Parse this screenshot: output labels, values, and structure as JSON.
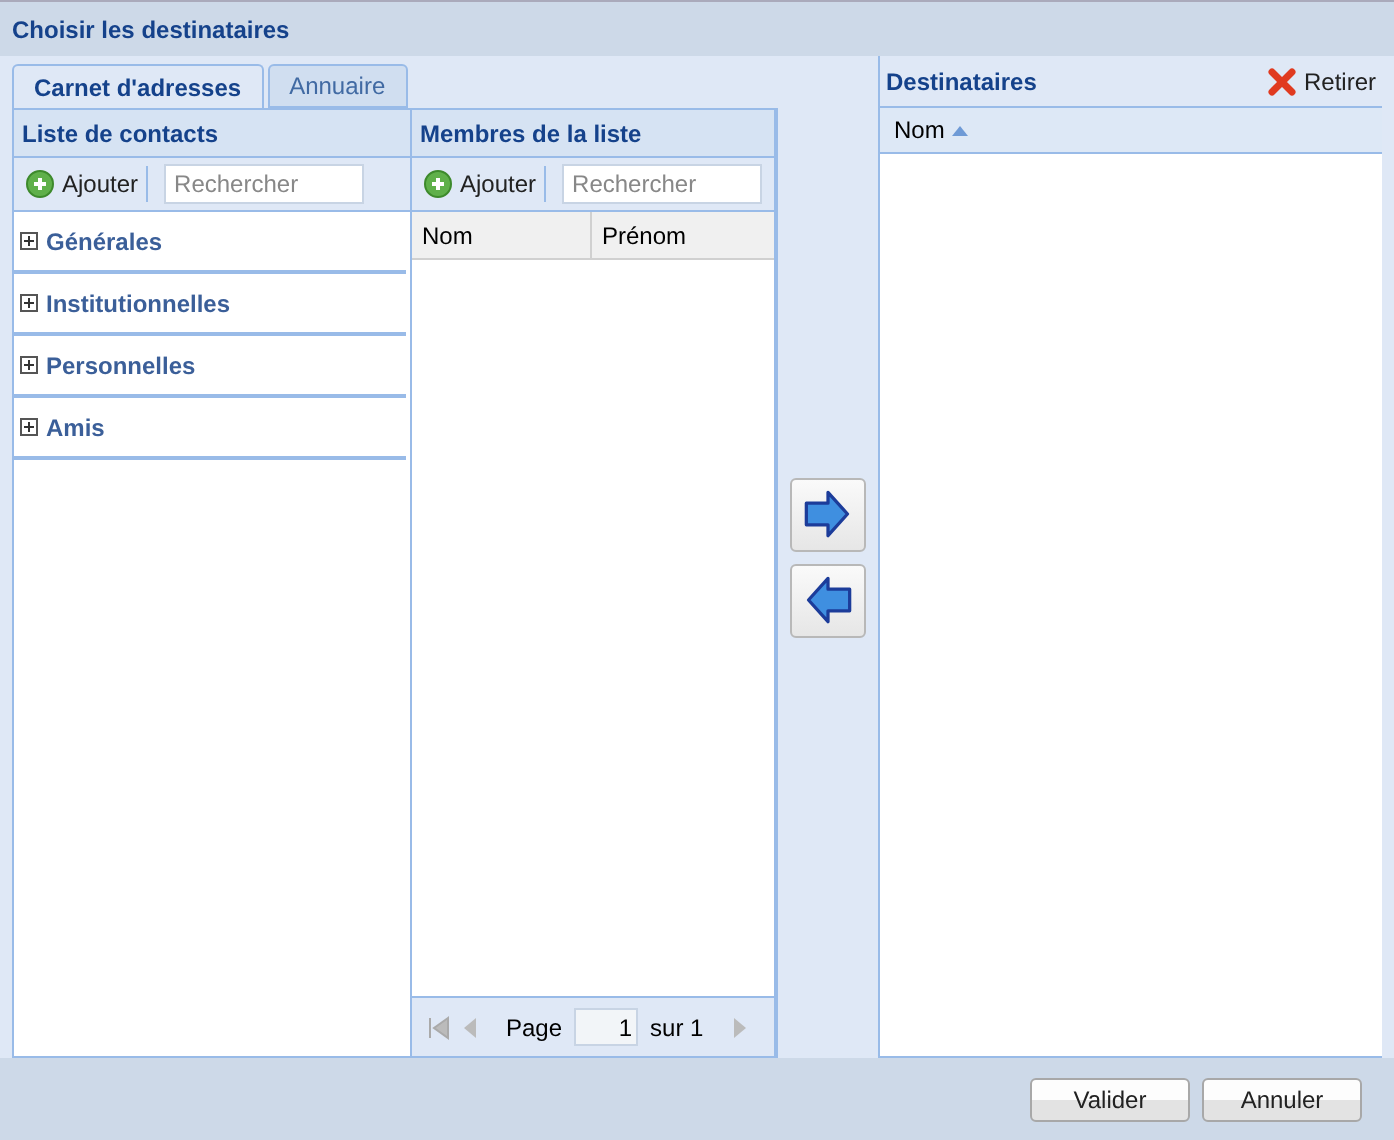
{
  "window": {
    "title": "Choisir les destinataires"
  },
  "tabs": [
    {
      "label": "Carnet d'adresses",
      "selected": true
    },
    {
      "label": "Annuaire",
      "selected": false
    }
  ],
  "contacts": {
    "title": "Liste de contacts",
    "add": "Ajouter",
    "search": {
      "placeholder": "Rechercher"
    },
    "groups": [
      {
        "label": "Générales",
        "expanded": false
      },
      {
        "label": "Institutionnelles",
        "expanded": false
      },
      {
        "label": "Personnelles",
        "expanded": false
      },
      {
        "label": "Amis",
        "expanded": false
      }
    ]
  },
  "members": {
    "title": "Membres de la liste",
    "add": "Ajouter",
    "search": {
      "placeholder": "Rechercher"
    },
    "columns": [
      "Nom",
      "Prénom"
    ],
    "pager": {
      "page_label": "Page",
      "page": "1",
      "of": "sur 1"
    }
  },
  "recipients": {
    "title": "Destinataires",
    "remove": "Retirer",
    "columns": [
      "Nom"
    ]
  },
  "buttons": [
    "Valider",
    "Annuler"
  ]
}
